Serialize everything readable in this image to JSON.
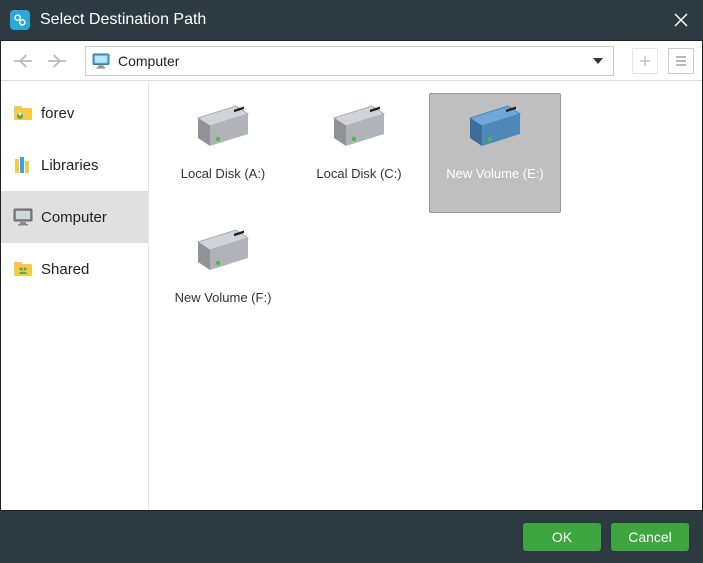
{
  "titlebar": {
    "title": "Select Destination Path"
  },
  "toolbar": {
    "path": "Computer"
  },
  "sidebar": {
    "items": [
      {
        "label": "forev"
      },
      {
        "label": "Libraries"
      },
      {
        "label": "Computer"
      },
      {
        "label": "Shared"
      }
    ]
  },
  "drives": [
    {
      "label": "Local Disk (A:)",
      "selected": false,
      "tint": "gray"
    },
    {
      "label": "Local Disk (C:)",
      "selected": false,
      "tint": "gray"
    },
    {
      "label": "New Volume (E:)",
      "selected": true,
      "tint": "blue"
    },
    {
      "label": "New Volume (F:)",
      "selected": false,
      "tint": "gray"
    }
  ],
  "footer": {
    "ok": "OK",
    "cancel": "Cancel"
  }
}
